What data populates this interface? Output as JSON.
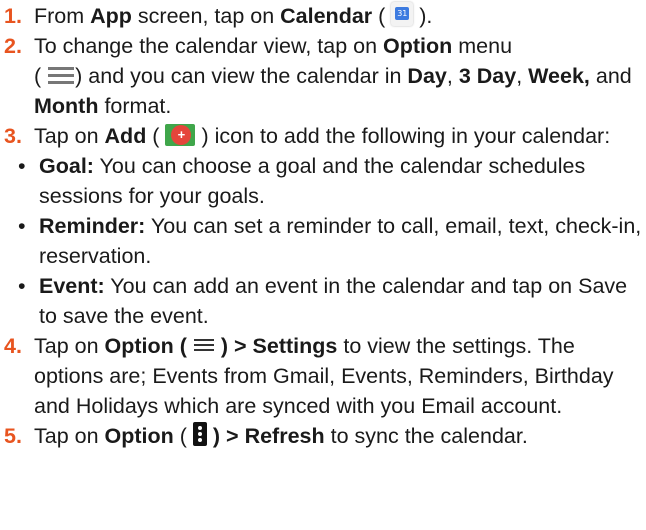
{
  "steps": [
    {
      "num": "1.",
      "t1": "From ",
      "b1": "App",
      "t2": " screen, tap on ",
      "b2": "Calendar",
      "t3": " (",
      "icon": "calendar-app-icon",
      "icon_text": "31",
      "t4": ")."
    },
    {
      "num": "2.",
      "t1": "To change the calendar view, tap on ",
      "b1": "Option",
      "t2": " menu",
      "t3": "(",
      "icon": "hamburger-menu-icon",
      "t4": ") and you can view the calendar in ",
      "b2": "Day",
      "t5": ", ",
      "b3": "3 Day",
      "t6": ", ",
      "b4": "Week,",
      "t7": " and ",
      "b5": "Month",
      "t8": " format."
    },
    {
      "num": "3.",
      "t1": "Tap on ",
      "b1": "Add",
      "t2": " (",
      "icon": "add-plus-icon",
      "t3": ") icon to add the following in your calendar:",
      "bullets": [
        {
          "label": "Goal:",
          "text": " You can choose a goal and the calendar schedules sessions for your goals."
        },
        {
          "label": "Reminder:",
          "text": " You can set a reminder to call, email, text, check-in, reservation."
        },
        {
          "label": "Event:",
          "text": " You can add an event in the calendar and tap on Save to save the event."
        }
      ]
    },
    {
      "num": "4.",
      "t1": "Tap on ",
      "b1": "Option (",
      "icon": "hamburger-menu-icon",
      "b2": ") > Settings",
      "t2": " to view the settings. The options are; Events from Gmail, Events, Reminders, Birthday and Holidays which are  synced with you Email account."
    },
    {
      "num": "5.",
      "t1": "Tap on ",
      "b1": "Option",
      "t2": " (",
      "icon": "more-vert-icon",
      "b2": ") > Refresh",
      "t3": " to sync the calendar."
    }
  ],
  "colors": {
    "step_number": "#e8541f",
    "text": "#1a1a1a"
  }
}
